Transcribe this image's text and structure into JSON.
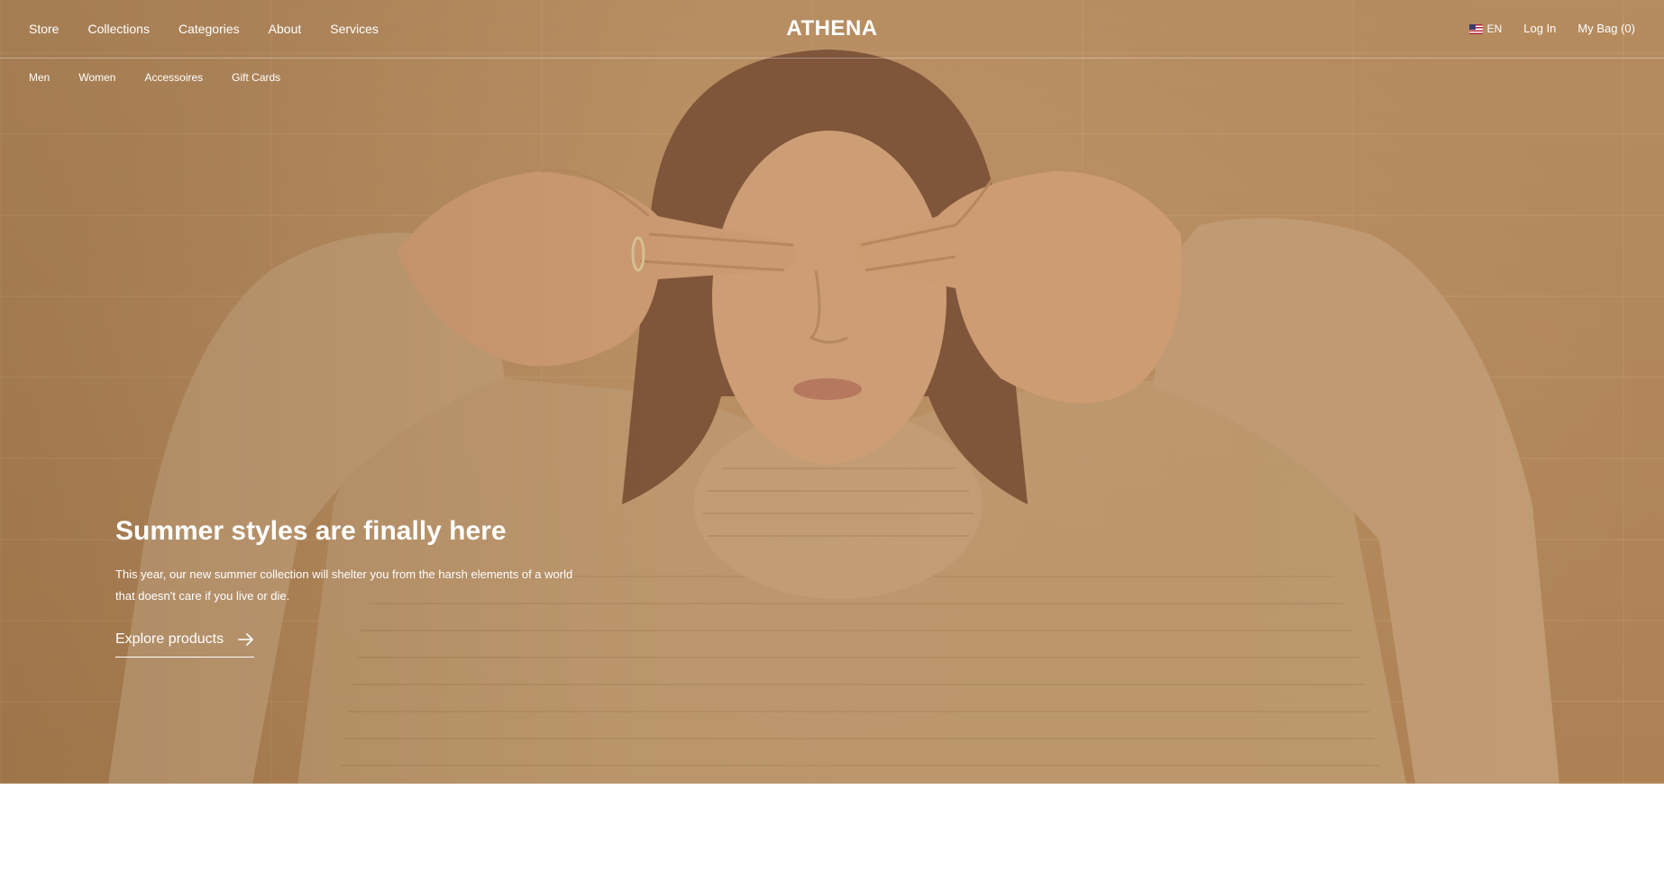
{
  "header": {
    "brand": "ATHENA",
    "nav_left": [
      {
        "label": "Store"
      },
      {
        "label": "Collections"
      },
      {
        "label": "Categories"
      },
      {
        "label": "About"
      },
      {
        "label": "Services"
      }
    ],
    "language": {
      "code": "EN",
      "flag_icon": "us-flag-icon"
    },
    "login_label": "Log In",
    "bag_label": "My Bag (0)"
  },
  "subnav": [
    {
      "label": "Men"
    },
    {
      "label": "Women"
    },
    {
      "label": "Accessoires"
    },
    {
      "label": "Gift Cards"
    }
  ],
  "hero": {
    "title": "Summer styles are finally here",
    "description": "This year, our new summer collection will shelter you from the harsh elements of a world that doesn't care if you live or die.",
    "cta_label": "Explore products",
    "cta_icon": "arrow-right-icon",
    "image_alt": "hero-photo"
  },
  "colors": {
    "hero_tone": "#c09870",
    "text": "#ffffff",
    "page_background": "#ffffff"
  }
}
